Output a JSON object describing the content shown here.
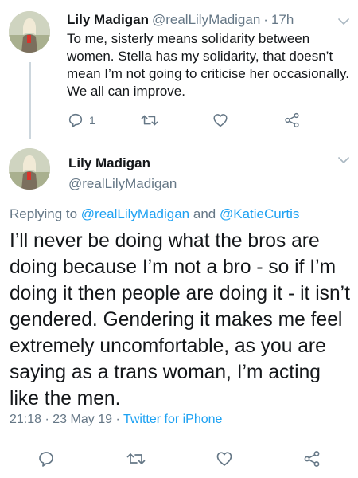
{
  "tweet1": {
    "author_name": "Lily Madigan",
    "handle": "@realLilyMadigan",
    "separator": "·",
    "time": "17h",
    "text": "To me, sisterly means solidarity between women. Stella has my solidarity, that doesn’t mean I’m not going to criticise her occasionally. We all can improve.",
    "reply_count": "1",
    "icons": [
      "reply-icon",
      "retweet-icon",
      "like-icon",
      "share-icon",
      "chevron-down-icon"
    ]
  },
  "tweet2": {
    "author_name": "Lily Madigan",
    "handle": "@realLilyMadigan",
    "replying_prefix": "Replying to",
    "replying_mention_1": "@realLilyMadigan",
    "replying_and": "and",
    "replying_mention_2": "@KatieCurtis",
    "text": "I’ll never be doing what the bros are doing because I’m not a bro - so if I’m doing it then people are doing it - it isn’t gendered. Gendering it makes me feel extremely uncomfortable, as you are saying as a trans woman, I’m acting like the men.",
    "time": "21:18",
    "separator": "·",
    "date": "23 May 19",
    "source": "Twitter for iPhone",
    "icons": [
      "reply-icon",
      "retweet-icon",
      "like-icon",
      "share-icon",
      "chevron-down-icon"
    ]
  },
  "colors": {
    "text": "#14171a",
    "muted": "#657786",
    "link": "#1da1f2",
    "divider": "#e1e8ed",
    "thread_line": "#ccd6dd"
  }
}
